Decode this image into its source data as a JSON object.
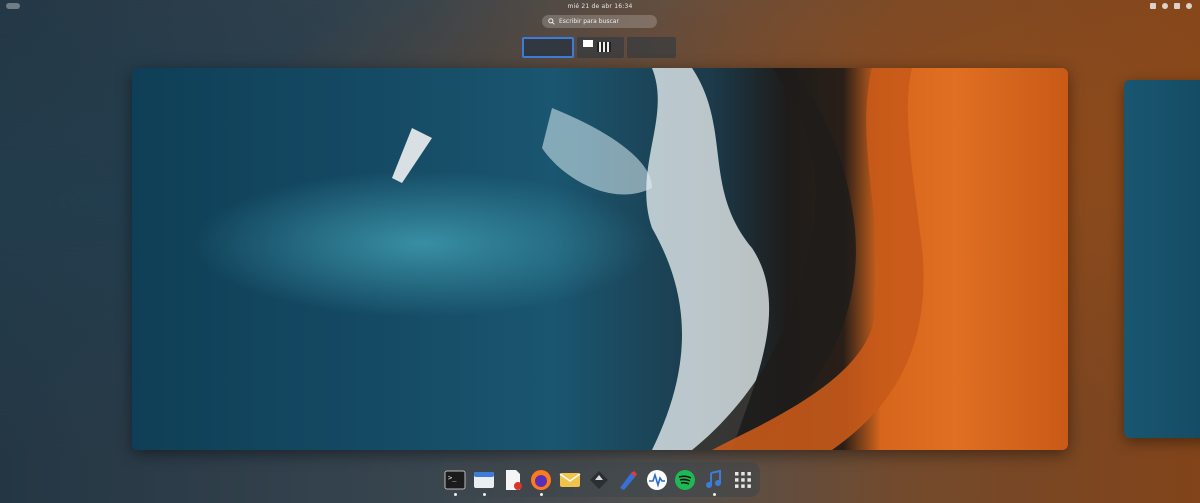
{
  "topbar": {
    "activities_icon": "activities-pill-icon",
    "clock": "mié 21 de abr  16:34",
    "tray_icons": [
      "screen-icon",
      "accessibility-icon",
      "network-icon",
      "power-icon"
    ]
  },
  "search": {
    "placeholder": "Escribir para buscar",
    "icon": "search-icon"
  },
  "workspaces": {
    "count": 3,
    "active_index": 0
  },
  "dock": {
    "apps": [
      {
        "name": "terminal",
        "icon": "terminal-icon",
        "running": true
      },
      {
        "name": "files",
        "icon": "file-manager-icon",
        "running": true
      },
      {
        "name": "text-editor",
        "icon": "text-editor-icon",
        "running": false
      },
      {
        "name": "firefox",
        "icon": "firefox-icon",
        "running": true
      },
      {
        "name": "mail",
        "icon": "mail-icon",
        "running": false
      },
      {
        "name": "inkscape",
        "icon": "inkscape-icon",
        "running": false
      },
      {
        "name": "foliate",
        "icon": "pen-icon",
        "running": false
      },
      {
        "name": "system-monitor",
        "icon": "monitor-icon",
        "running": false
      },
      {
        "name": "spotify",
        "icon": "spotify-icon",
        "running": false
      },
      {
        "name": "music",
        "icon": "music-icon",
        "running": true
      },
      {
        "name": "app-grid",
        "icon": "app-grid-icon",
        "running": false
      }
    ]
  },
  "colors": {
    "accent": "#3d7dd9",
    "ocean": "#164c66",
    "sand": "#e06f23"
  }
}
